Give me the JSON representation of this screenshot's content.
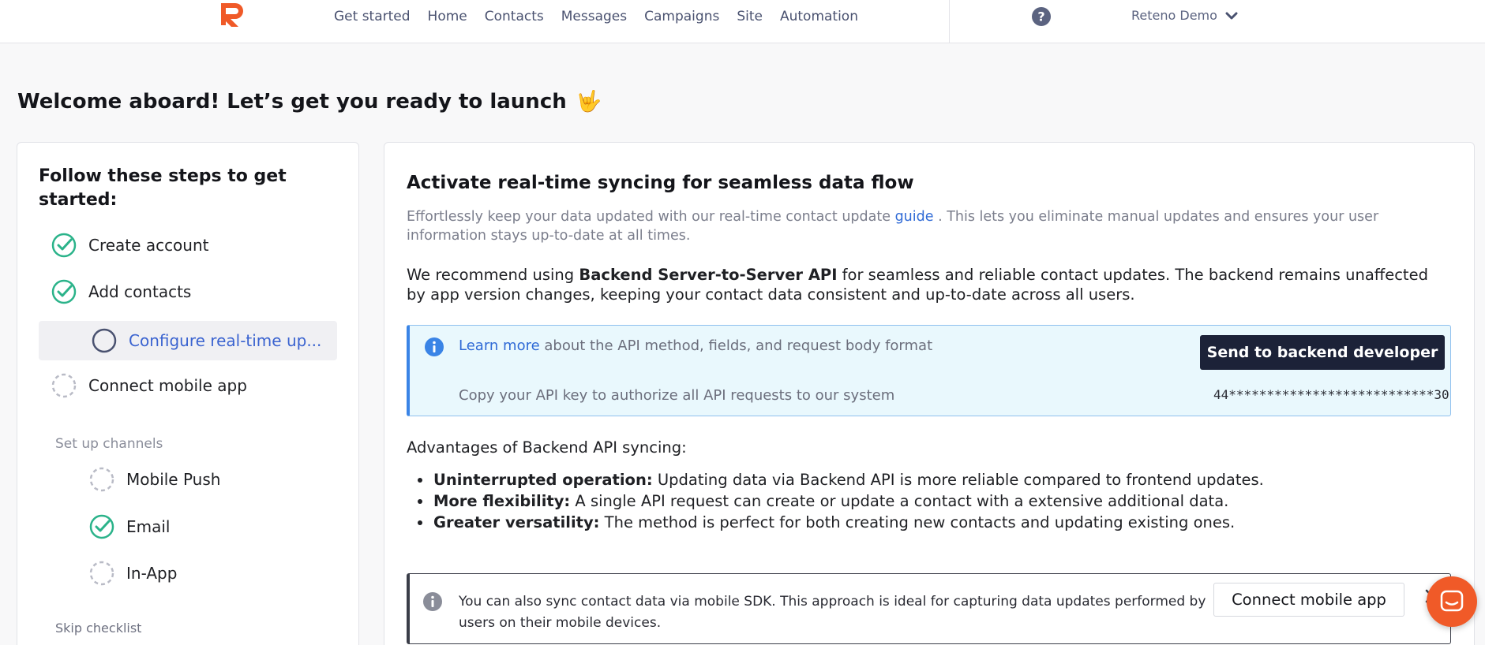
{
  "nav": {
    "items": [
      "Get started",
      "Home",
      "Contacts",
      "Messages",
      "Campaigns",
      "Site",
      "Automation"
    ],
    "account_name": "Reteno Demo"
  },
  "page": {
    "title": "Welcome aboard! Let’s get you ready to launch",
    "title_emoji": "🤟"
  },
  "checklist": {
    "heading": "Follow these steps to get started:",
    "steps": [
      {
        "label": "Create account",
        "status": "done"
      },
      {
        "label": "Add contacts",
        "status": "done"
      },
      {
        "label": "Configure real-time up...",
        "status": "active"
      },
      {
        "label": "Connect mobile app",
        "status": "todo"
      }
    ],
    "channels_label": "Set up channels",
    "channels": [
      {
        "label": "Mobile Push",
        "status": "todo"
      },
      {
        "label": "Email",
        "status": "done"
      },
      {
        "label": "In-App",
        "status": "todo"
      }
    ],
    "skip_label": "Skip checklist"
  },
  "main": {
    "title": "Activate real-time syncing for seamless data flow",
    "desc_before": "Effortlessly keep your data updated with our real-time contact update ",
    "desc_link": "guide",
    "desc_after": " . This lets you eliminate manual updates and ensures your user information stays up-to-date at all times.",
    "recommend_before": "We recommend using ",
    "recommend_bold": "Backend Server-to-Server API",
    "recommend_after": " for seamless and reliable contact updates. The backend remains unaffected by app version changes, keeping your contact data consistent and up-to-date across all users.",
    "api_box": {
      "learn_link": "Learn more",
      "learn_text": " about the API method, fields, and request body format",
      "send_button": "Send to backend developer",
      "copy_text": "Copy your API key to authorize all API requests to our system",
      "api_key": "44***************************30"
    },
    "advantages_heading": "Advantages of Backend API syncing:",
    "advantages": [
      {
        "bold": "Uninterrupted operation:",
        "text": " Updating data via Backend API is more reliable compared to frontend updates."
      },
      {
        "bold": "More flexibility:",
        "text": " A single API request can create or update a contact with a extensive additional data."
      },
      {
        "bold": "Greater versatility:",
        "text": " The method is perfect for both creating new contacts and updating existing ones."
      }
    ],
    "sdk_box": {
      "text": "You can also sync contact data via mobile SDK. This approach is ideal for capturing data updates performed by users on their mobile devices.",
      "button": "Connect mobile app"
    }
  },
  "colors": {
    "brand": "#f05a28",
    "link": "#2f6ad6",
    "success": "#2bb38a",
    "dark_button": "#1c2238",
    "info_bg": "#e9f8fd"
  },
  "icons": {
    "logo": "reteno-logo-icon",
    "help": "question-circle-icon",
    "account_chevron": "chevron-down-icon",
    "step_done": "check-circle-icon",
    "step_active": "empty-circle-icon",
    "step_todo": "dashed-circle-icon",
    "info": "info-circle-icon",
    "close": "close-icon",
    "chat": "chat-icon"
  }
}
